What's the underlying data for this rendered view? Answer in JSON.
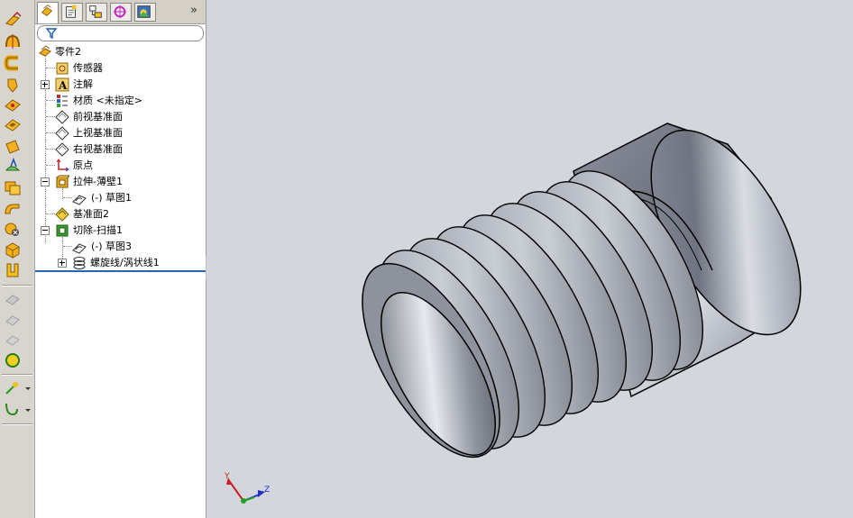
{
  "toolbar": {
    "icons": [
      "extruded-boss-icon",
      "revolved-boss-icon",
      "swept-boss-icon",
      "lofted-boss-icon",
      "fillet-icon",
      "chamfer-icon",
      "rib-icon",
      "shell-icon",
      "draft-icon",
      "hole-wizard-icon",
      "dome-icon",
      "wrap-icon",
      "grayed-feature-icon",
      "grayed-feature-icon",
      "grayed-feature-icon",
      "reference-geometry-icon",
      "sketch-entities-icon",
      "curves-icon"
    ]
  },
  "panel": {
    "tabs": [
      "featuremanager-tab",
      "propertymanager-tab",
      "configurationmanager-tab",
      "dimxpert-tab",
      "display-manager-tab"
    ],
    "more_label": "»",
    "filter": {
      "value": ""
    }
  },
  "tree": {
    "root": "零件2",
    "items": [
      {
        "label": "传感器",
        "icon": "sensor-icon"
      },
      {
        "label": "注解",
        "icon": "annotations-icon"
      },
      {
        "label": "材质 <未指定>",
        "icon": "material-icon"
      },
      {
        "label": "前视基准面",
        "icon": "plane-icon"
      },
      {
        "label": "上视基准面",
        "icon": "plane-icon"
      },
      {
        "label": "右视基准面",
        "icon": "plane-icon"
      },
      {
        "label": "原点",
        "icon": "origin-icon"
      },
      {
        "label": "拉伸-薄壁1",
        "icon": "extrude-thin-icon"
      },
      {
        "label": "(-) 草图1",
        "icon": "sketch-icon"
      },
      {
        "label": "基准面2",
        "icon": "plane2-icon"
      },
      {
        "label": "切除-扫描1",
        "icon": "cut-sweep-icon"
      },
      {
        "label": "(-) 草图3",
        "icon": "sketch-icon"
      },
      {
        "label": "螺旋线/涡状线1",
        "icon": "helix-icon"
      }
    ]
  },
  "viewport": {
    "triad": {
      "x_label": "X",
      "y_label": "Y",
      "z_label": "Z"
    }
  }
}
